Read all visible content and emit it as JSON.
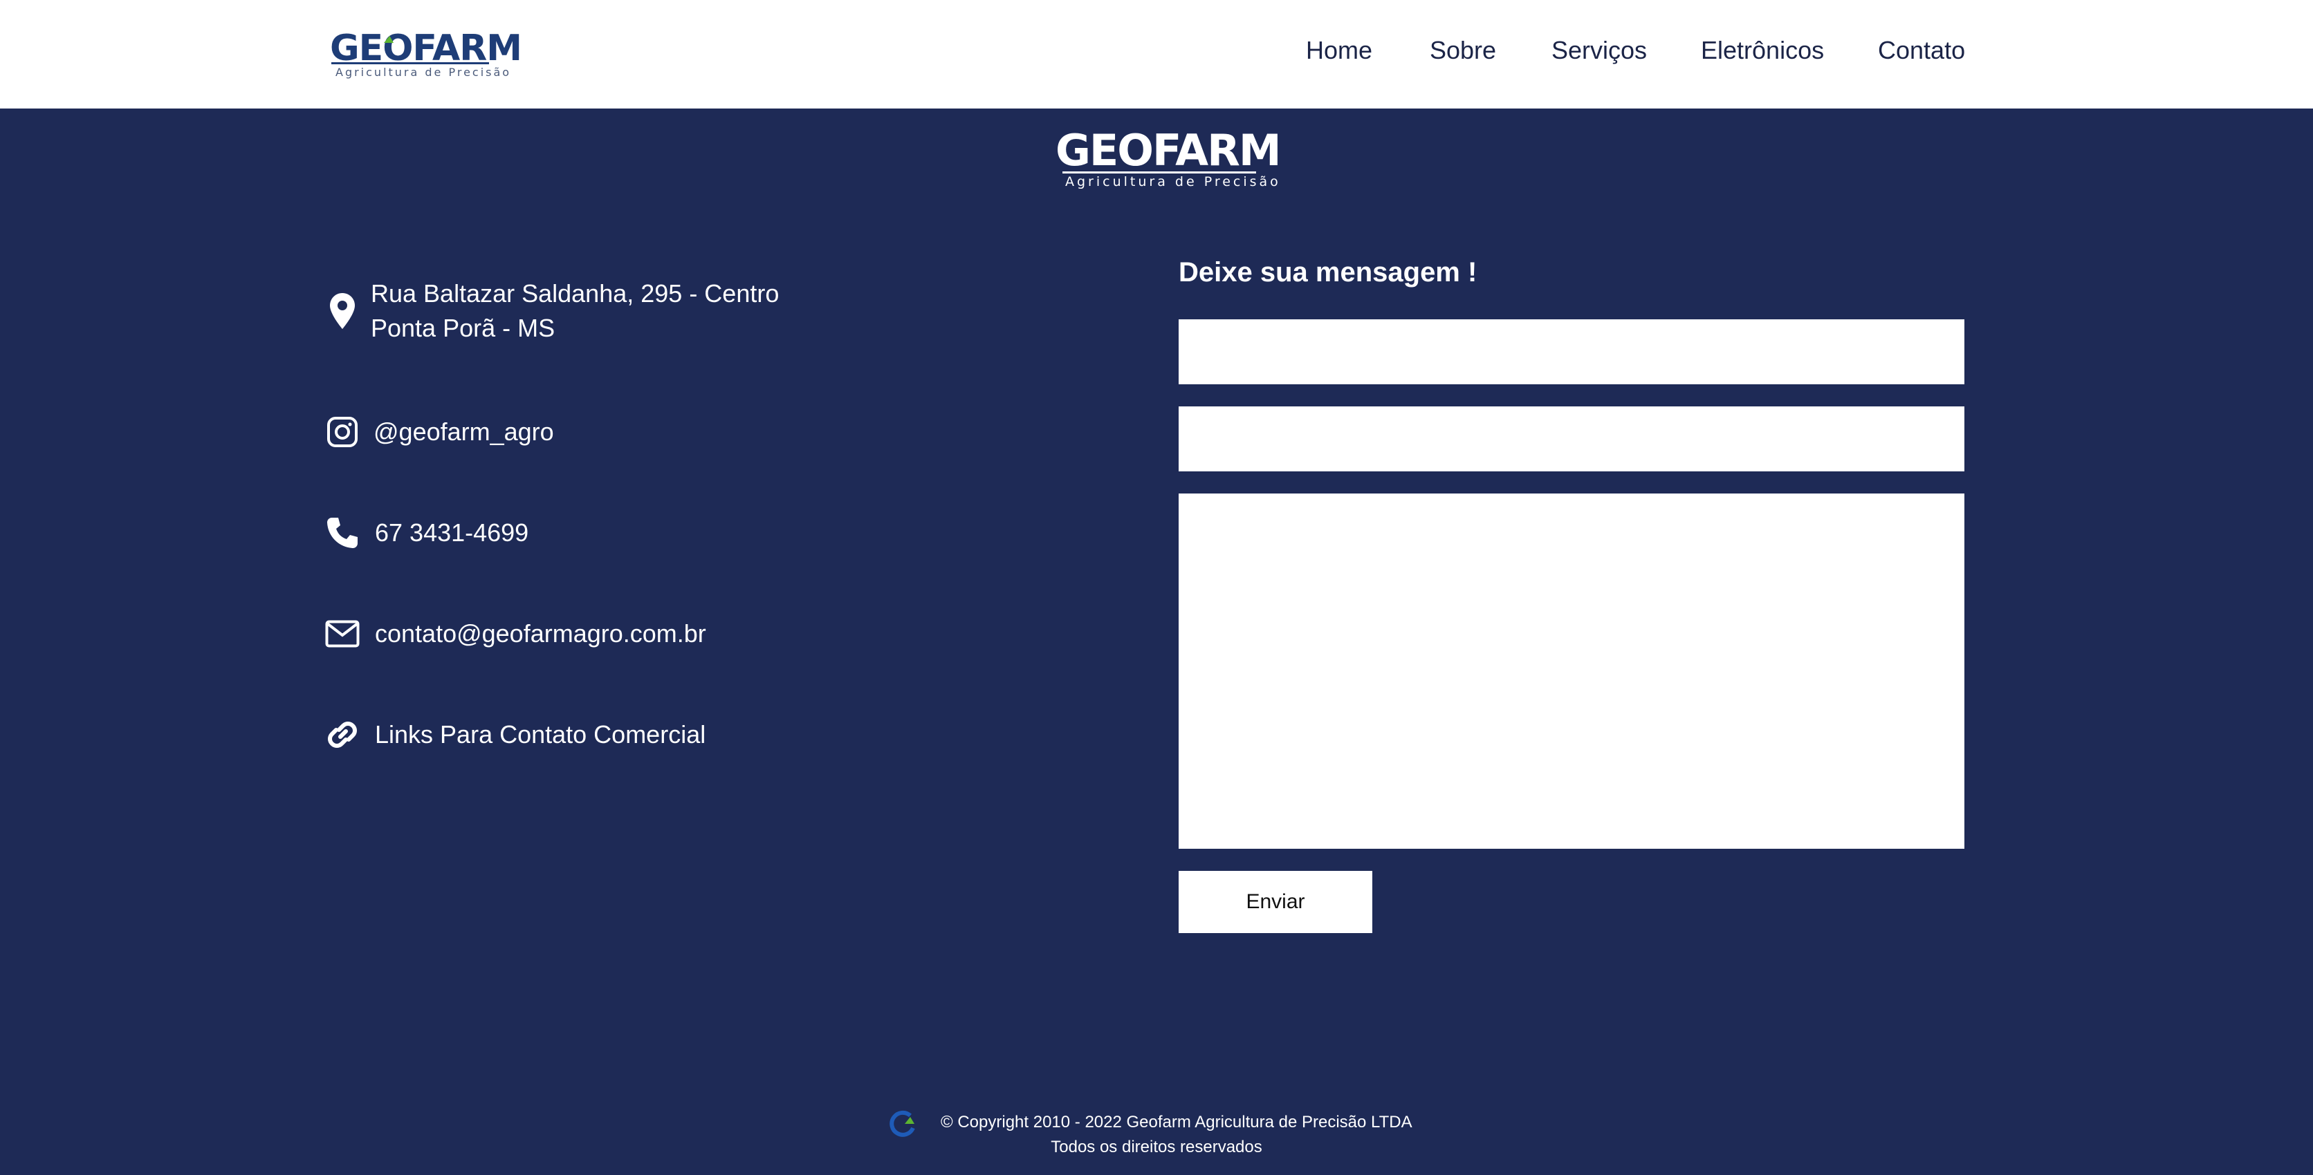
{
  "brand": {
    "name": "GEOFARM",
    "tagline": "Agricultura  de  Precisão",
    "accent_color": "#5cb531",
    "primary_color": "#1e3d77",
    "background_color": "#1e2a56"
  },
  "nav": {
    "items": [
      {
        "label": "Home"
      },
      {
        "label": "Sobre"
      },
      {
        "label": "Serviços"
      },
      {
        "label": "Eletrônicos"
      },
      {
        "label": "Contato"
      }
    ]
  },
  "contact": {
    "address_line1": "Rua Baltazar Saldanha, 295 - Centro",
    "address_line2": "Ponta Porã - MS",
    "instagram": "@geofarm_agro",
    "phone": "67 3431-4699",
    "email": "contato@geofarmagro.com.br",
    "links": "Links Para Contato Comercial",
    "icons": [
      "location-pin-icon",
      "instagram-icon",
      "phone-icon",
      "envelope-icon",
      "link-icon"
    ]
  },
  "form": {
    "title": "Deixe sua mensagem !",
    "name_value": "",
    "email_value": "",
    "message_value": "",
    "submit_label": "Enviar"
  },
  "footer": {
    "copyright": "© Copyright 2010 - 2022 Geofarm Agricultura de Precisão LTDA",
    "rights": "Todos os direitos reservados"
  }
}
